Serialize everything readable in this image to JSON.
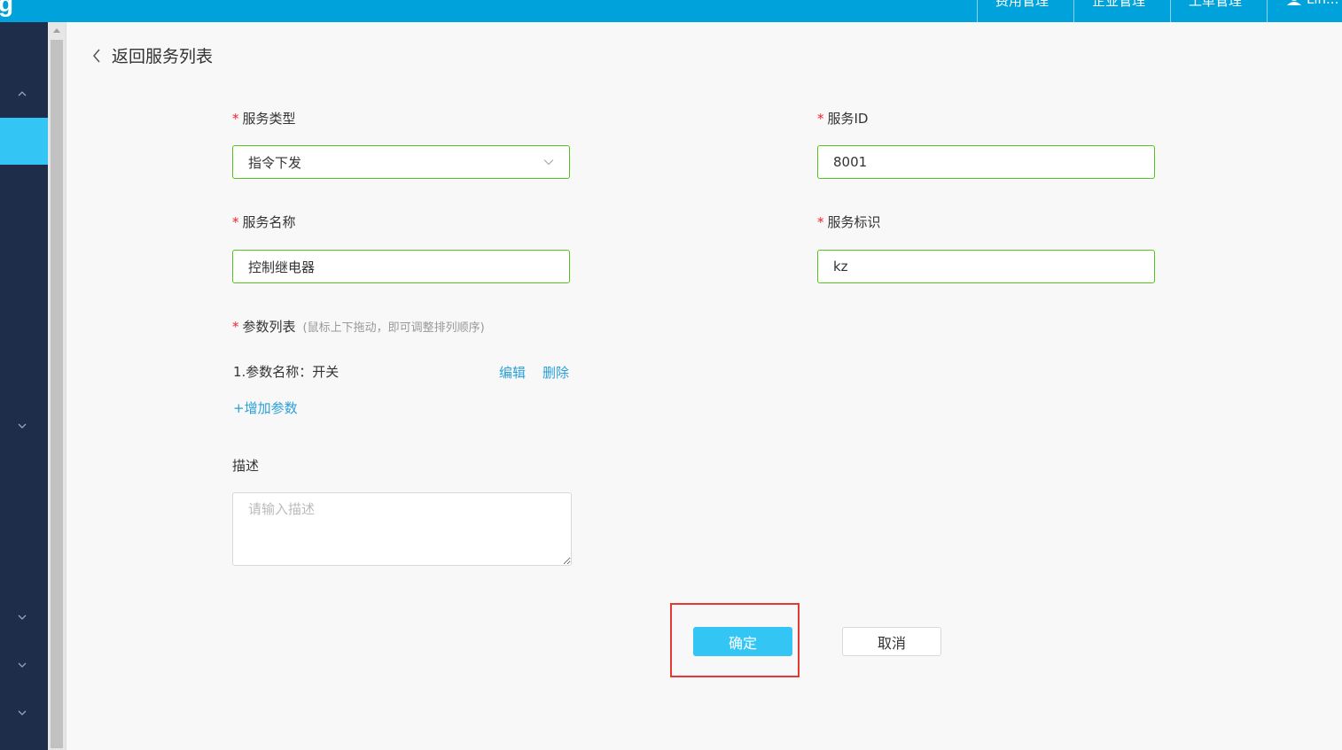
{
  "app": {
    "logo_text": "g",
    "top_nav": [
      {
        "label": "费用管理"
      },
      {
        "label": "企业管理"
      },
      {
        "label": "工单管理"
      }
    ],
    "user_name": "Lin..."
  },
  "form": {
    "back_label": "返回服务列表",
    "service_type": {
      "label": "服务类型",
      "value": "指令下发"
    },
    "service_id": {
      "label": "服务ID",
      "value": "8001"
    },
    "service_name": {
      "label": "服务名称",
      "value": "控制继电器"
    },
    "service_key": {
      "label": "服务标识",
      "value": "kz"
    },
    "params": {
      "label": "参数列表",
      "hint": "(鼠标上下拖动，即可调整排列顺序)",
      "items": [
        {
          "text": "1.参数名称：开关",
          "edit_label": "编辑",
          "delete_label": "删除"
        }
      ],
      "add_label": "+增加参数"
    },
    "description": {
      "label": "描述",
      "placeholder": "请输入描述"
    },
    "confirm_label": "确定",
    "cancel_label": "取消",
    "required_mark": "*"
  },
  "colors": {
    "topbar": "#00a2dc",
    "sidebar": "#1e2d4a",
    "sidebar_active": "#33c6f5",
    "input_border": "#52c41a",
    "link": "#2aa0d8",
    "highlight": "#e53935"
  }
}
